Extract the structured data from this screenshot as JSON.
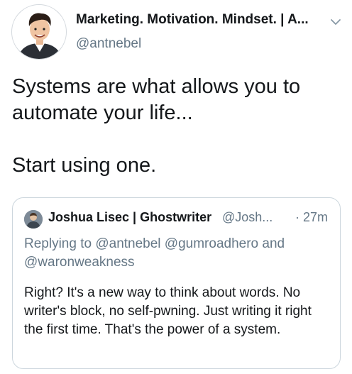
{
  "author": {
    "display_name": "Marketing. Motivation. Mindset. | A...",
    "handle": "@antnebel",
    "avatar_icon": "cartoon-portrait-avatar"
  },
  "tweet": {
    "lines": [
      "Systems are what allows you to automate your life...",
      "Start using one."
    ]
  },
  "quoted_tweet": {
    "author_name": "Joshua Lisec | Ghostwriter",
    "author_handle": "@Josh...",
    "time": "· 27m",
    "replying_prefix": "Replying to",
    "replying_mentions": "@antnebel @gumroadhero",
    "replying_and": "and",
    "replying_last": "@waronweakness",
    "text": "Right? It's a new way to think about words. No writer's block, no self-pwning. Just writing it right the first time. That's the power of a system."
  },
  "colors": {
    "primary_text": "#14171a",
    "secondary_text": "#657786",
    "border": "#ccd6dd"
  }
}
